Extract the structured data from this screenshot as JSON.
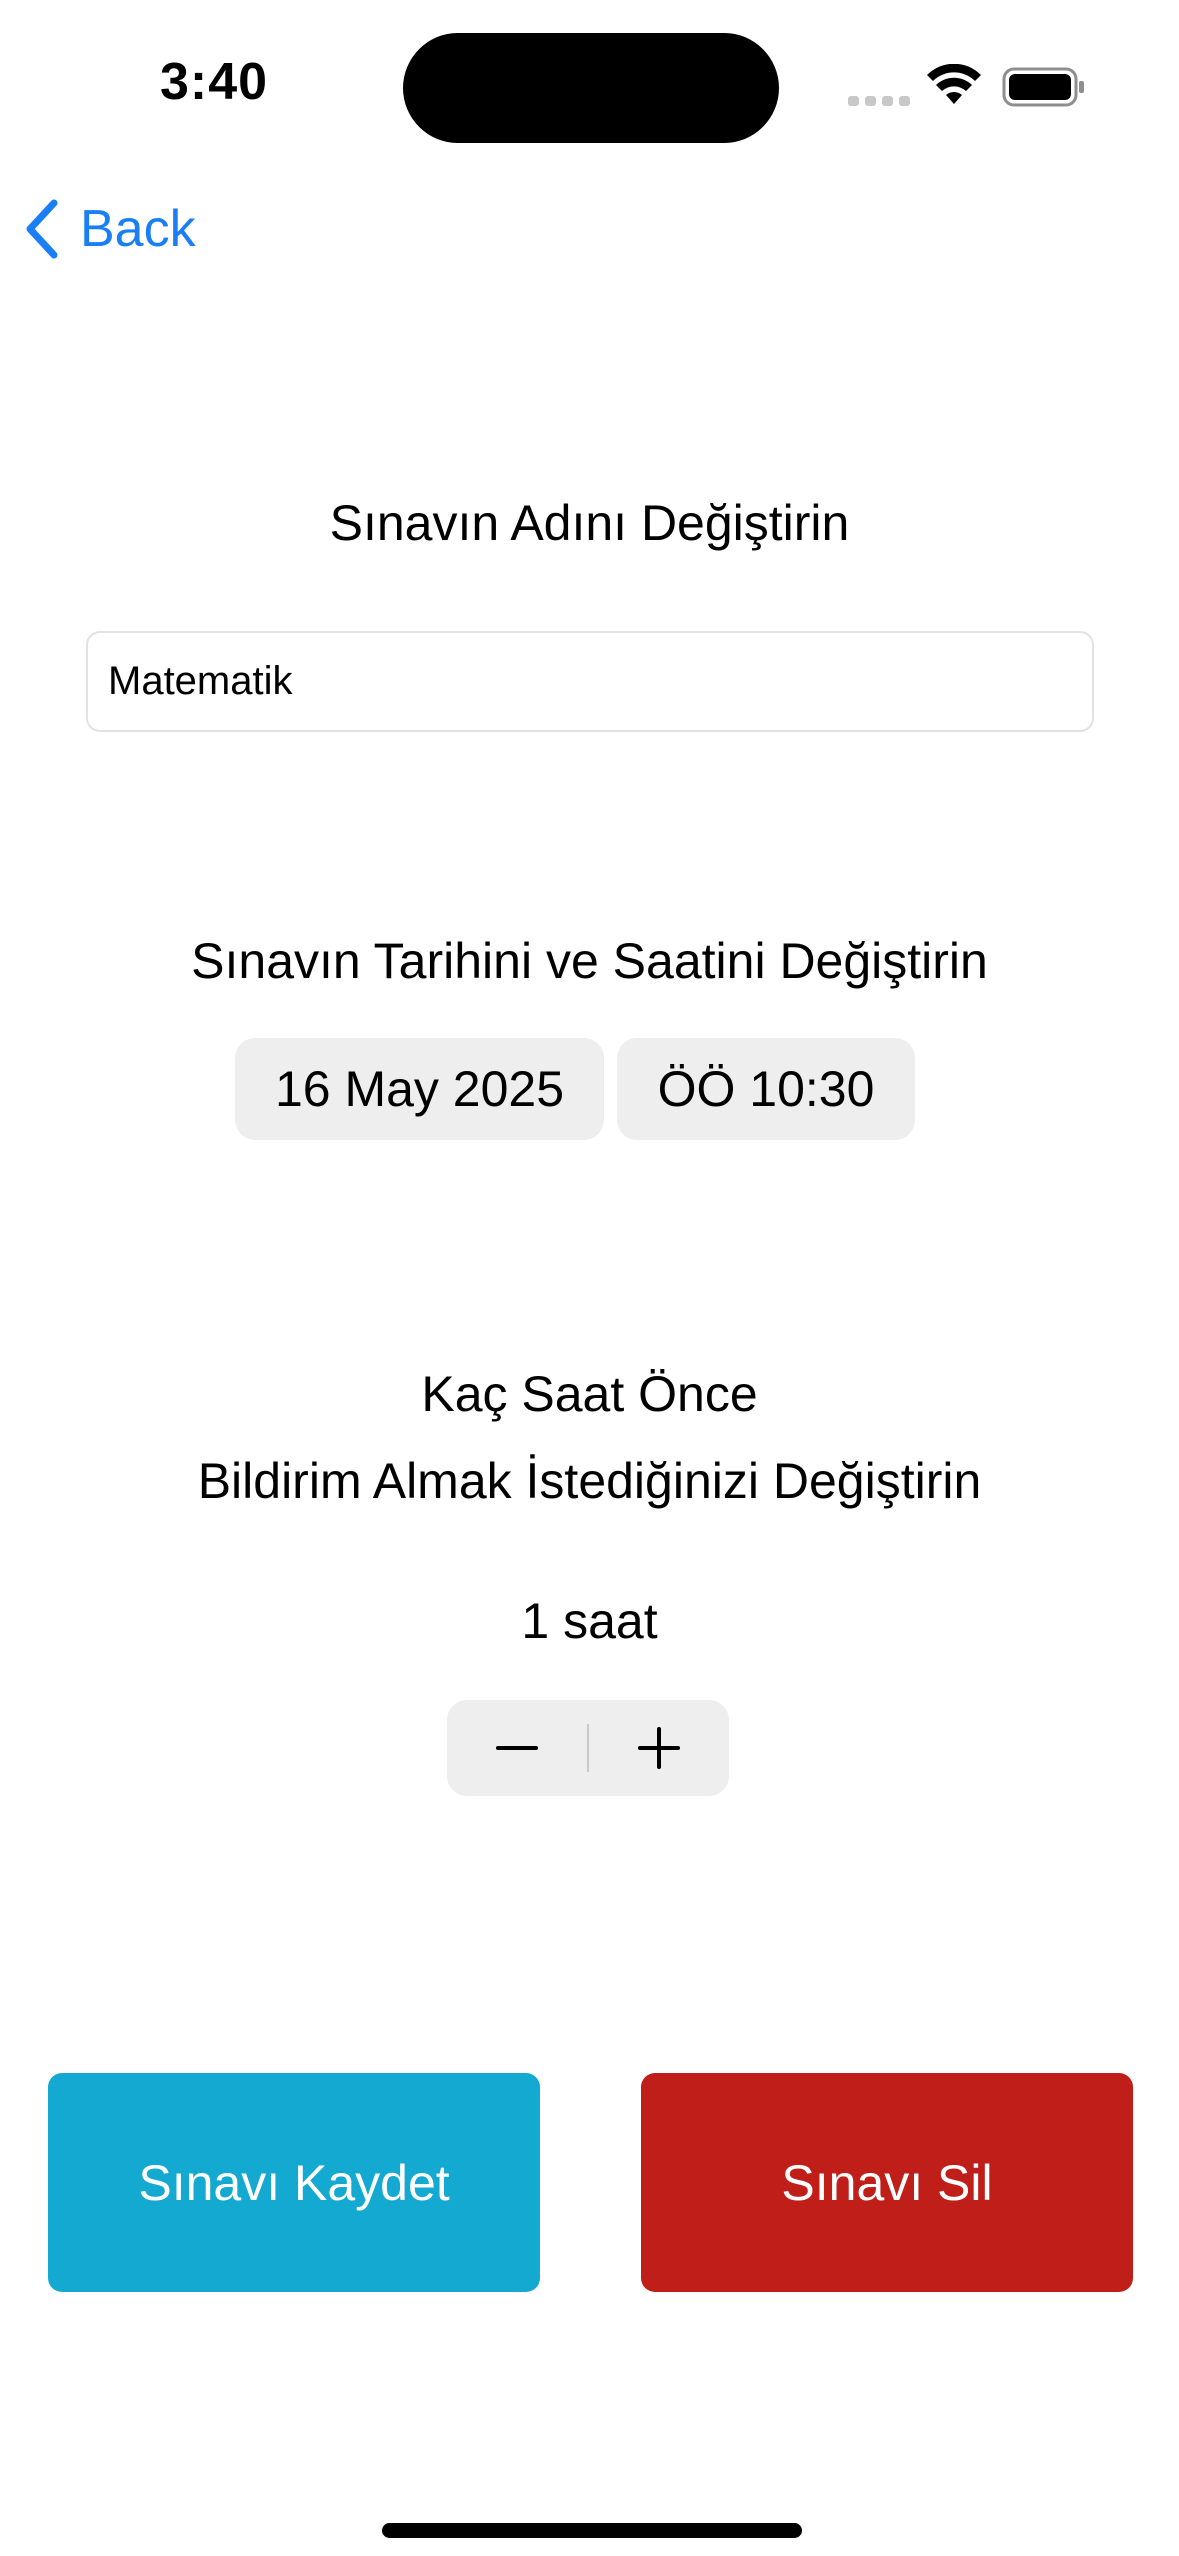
{
  "status_bar": {
    "time": "3:40",
    "icons": [
      "cellular-signal-icon",
      "wifi-icon",
      "battery-icon"
    ]
  },
  "nav": {
    "back_label": "Back",
    "back_icon": "chevron-left-icon"
  },
  "name_section": {
    "heading": "Sınavın Adını Değiştirin",
    "input_value": "Matematik"
  },
  "datetime_section": {
    "heading": "Sınavın Tarihini ve Saatini Değiştirin",
    "date": "16 May 2025",
    "time": "ÖÖ 10:30"
  },
  "reminder_section": {
    "heading_line1": "Kaç Saat Önce",
    "heading_line2": "Bildirim Almak İstediğinizi Değiştirin",
    "value": "1 saat",
    "stepper": {
      "minus_icon": "minus-icon",
      "plus_icon": "plus-icon"
    }
  },
  "actions": {
    "save_label": "Sınavı Kaydet",
    "delete_label": "Sınavı Sil"
  },
  "colors": {
    "accent": "#1a7ef7",
    "save": "#14a9d0",
    "delete": "#c01f19",
    "control_bg": "#eeeeef"
  }
}
